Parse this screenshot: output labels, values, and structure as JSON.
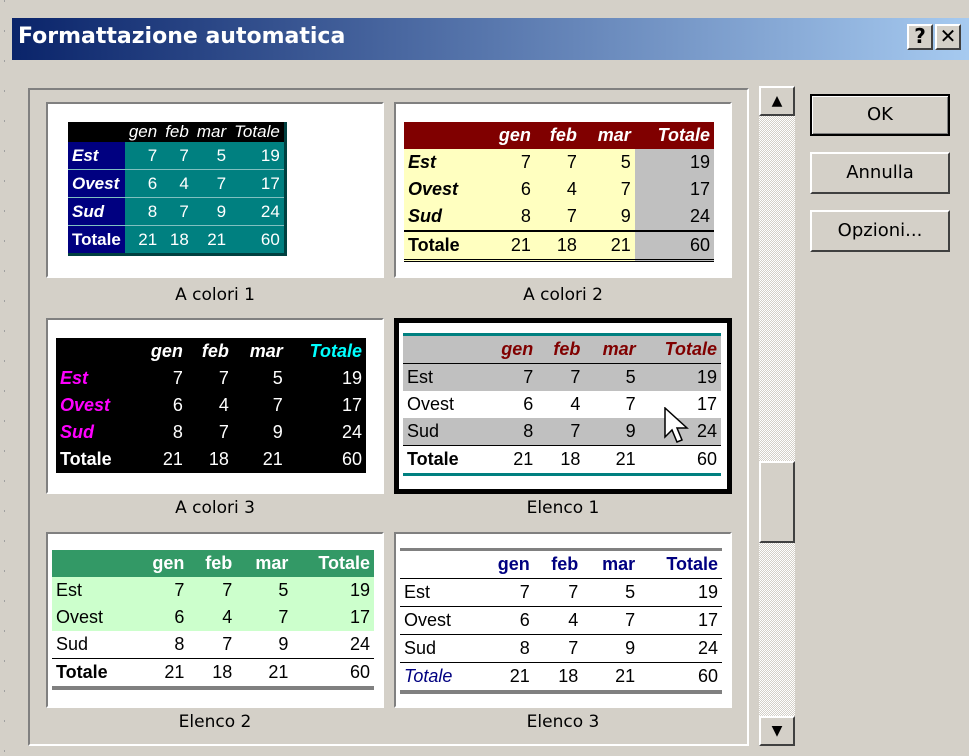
{
  "window": {
    "title": "Formattazione automatica",
    "help_label": "?",
    "close_label": "✕"
  },
  "buttons": {
    "ok": "OK",
    "cancel": "Annulla",
    "options": "Opzioni..."
  },
  "scrollbar": {
    "up_arrow": "▲",
    "down_arrow": "▼"
  },
  "sample": {
    "headers": [
      "",
      "gen",
      "feb",
      "mar",
      "Totale"
    ],
    "rows": [
      [
        "Est",
        "7",
        "7",
        "5",
        "19"
      ],
      [
        "Ovest",
        "6",
        "4",
        "7",
        "17"
      ],
      [
        "Sud",
        "8",
        "7",
        "9",
        "24"
      ],
      [
        "Totale",
        "21",
        "18",
        "21",
        "60"
      ]
    ]
  },
  "formats": [
    {
      "name": "A colori 1",
      "selected": false
    },
    {
      "name": "A colori 2",
      "selected": false
    },
    {
      "name": "A colori 3",
      "selected": false
    },
    {
      "name": "Elenco 1",
      "selected": true
    },
    {
      "name": "Elenco 2",
      "selected": false
    },
    {
      "name": "Elenco 3",
      "selected": false
    }
  ],
  "colors": {
    "title_gradient_start": "#0a246a",
    "teal": "#008080",
    "maroon": "#800000",
    "magenta": "#ff00ff",
    "cyan": "#00ffff",
    "navy": "#000080",
    "light_green": "#ccffcc",
    "green": "#339966"
  }
}
